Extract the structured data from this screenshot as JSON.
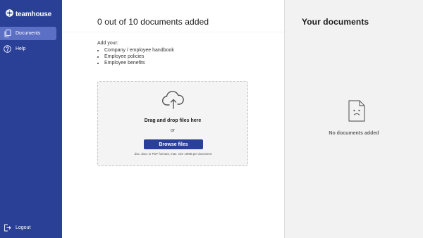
{
  "app": {
    "name": "teamhouse"
  },
  "sidebar": {
    "items": [
      {
        "label": "Documents",
        "icon": "documents-icon",
        "active": true
      },
      {
        "label": "Help",
        "icon": "help-icon",
        "active": false
      }
    ],
    "logout": {
      "label": "Logout",
      "icon": "logout-icon"
    }
  },
  "main": {
    "title": "0 out of 10 documents added",
    "intro": "Add your:",
    "items": [
      "Company / employee handbook",
      "Employee policies",
      "Employee benefits"
    ],
    "dropzone": {
      "title": "Drag and drop files here",
      "or": "or",
      "button": "Browse files",
      "note": ".doc .docx or PDF formats, max. size 10MB per document"
    }
  },
  "panel": {
    "title": "Your documents",
    "empty": "No documents added"
  },
  "colors": {
    "brand": "#2a3f96",
    "active": "#5b6fc4"
  }
}
